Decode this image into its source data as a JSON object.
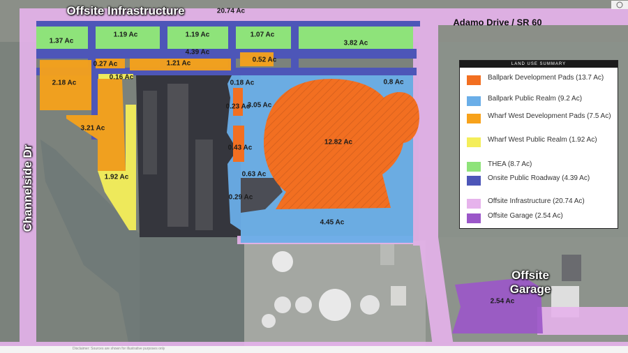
{
  "map_title": "Offsite Infrastructure",
  "roads": {
    "adamo": "Adamo Drive / SR 60",
    "channelside": "Channelside Dr"
  },
  "offsite_garage_label": "Offsite Garage",
  "parcels": {
    "offsite_total": "20.74 Ac",
    "thea_a": "1.37 Ac",
    "thea_b": "1.19 Ac",
    "thea_c": "1.19 Ac",
    "thea_d": "1.07 Ac",
    "thea_e": "3.82 Ac",
    "roadway": "4.39 Ac",
    "wwp_a": "0.27 Ac",
    "wwp_b": "1.21 Ac",
    "wwp_c": "0.52 Ac",
    "wwp_d": "2.18 Ac",
    "wwp_e": "3.21 Ac",
    "wwrealm_a": "0.16 Ac",
    "wwrealm_b": "1.92 Ac",
    "realm_a": "0.18 Ac",
    "realm_b": "0.23 Ac",
    "realm_c": "3.05 Ac",
    "realm_d": "0.8 Ac",
    "realm_e": "0.43 Ac",
    "realm_f": "0.63 Ac",
    "realm_g": "0.29 Ac",
    "realm_h": "4.45 Ac",
    "ballpark": "12.82 Ac",
    "garage": "2.54 Ac"
  },
  "legend": {
    "title": "LAND USE SUMMARY",
    "items": [
      {
        "label": "Ballpark Development Pads (13.7 Ac)",
        "color": "#f26f21"
      },
      {
        "label": "Ballpark Public Realm (9.2 Ac)",
        "color": "#6aaee8"
      },
      {
        "label": "Wharf West Development Pads (7.5 Ac)",
        "color": "#f7a21b"
      },
      {
        "label": "Wharf West Public Realm (1.92 Ac)",
        "color": "#f4ee5a"
      },
      {
        "label": "THEA (8.7 Ac)",
        "color": "#8ee37a"
      },
      {
        "label": "Onsite Public Roadway (4.39 Ac)",
        "color": "#4d56b8"
      },
      {
        "label": "Offsite Infrastructure (20.74 Ac)",
        "color": "#e6b3ec"
      },
      {
        "label": "Offsite Garage (2.54 Ac)",
        "color": "#9b57c9"
      }
    ]
  },
  "footer_note": "Disclaimer: Sources are shown for illustrative purposes only"
}
